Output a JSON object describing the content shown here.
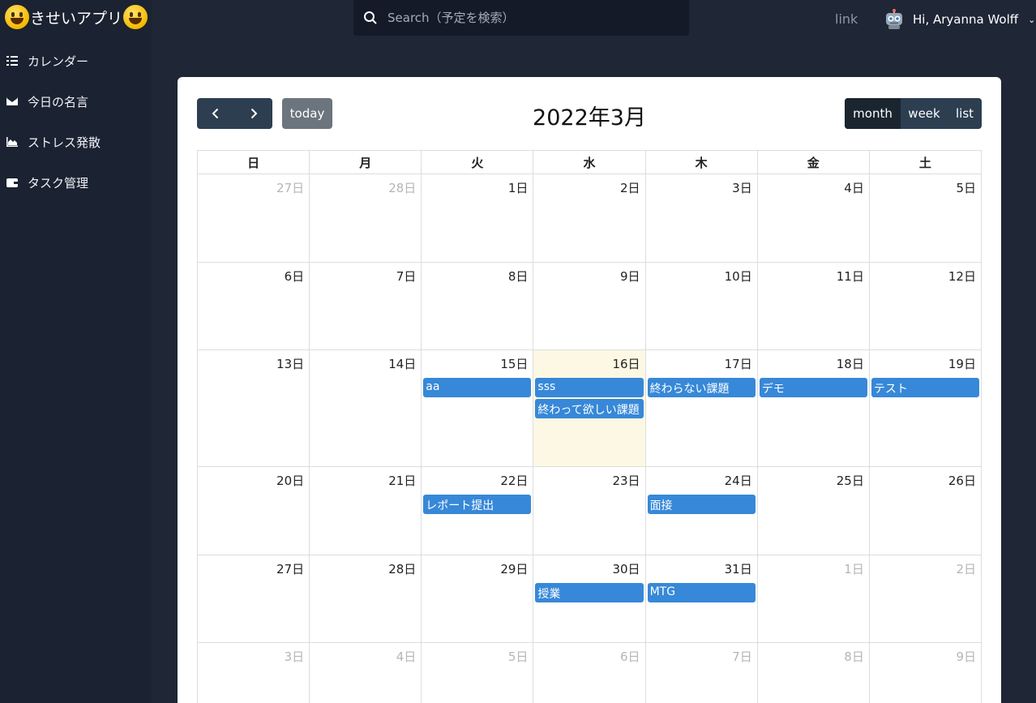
{
  "app": {
    "title": "きせいアプリ",
    "search_placeholder": "Search（予定を検索）",
    "link_label": "link",
    "user_greeting": "Hi, Aryanna Wolff",
    "accent": "#3788d8"
  },
  "sidebar": {
    "items": [
      {
        "label": "カレンダー",
        "icon": "list-icon"
      },
      {
        "label": "今日の名言",
        "icon": "envelope-icon"
      },
      {
        "label": "ストレス発散",
        "icon": "area-chart-icon"
      },
      {
        "label": "タスク管理",
        "icon": "wallet-icon"
      }
    ]
  },
  "calendar": {
    "title": "2022年3月",
    "today_label": "today",
    "views": {
      "month": "month",
      "week": "week",
      "list": "list"
    },
    "active_view": "month",
    "weekdays": [
      "日",
      "月",
      "火",
      "水",
      "木",
      "金",
      "土"
    ],
    "weeks": [
      [
        {
          "label": "27日",
          "other": true,
          "events": []
        },
        {
          "label": "28日",
          "other": true,
          "events": []
        },
        {
          "label": "1日",
          "events": []
        },
        {
          "label": "2日",
          "events": []
        },
        {
          "label": "3日",
          "events": []
        },
        {
          "label": "4日",
          "events": []
        },
        {
          "label": "5日",
          "events": []
        }
      ],
      [
        {
          "label": "6日",
          "events": []
        },
        {
          "label": "7日",
          "events": []
        },
        {
          "label": "8日",
          "events": []
        },
        {
          "label": "9日",
          "events": []
        },
        {
          "label": "10日",
          "events": []
        },
        {
          "label": "11日",
          "events": []
        },
        {
          "label": "12日",
          "events": []
        }
      ],
      [
        {
          "label": "13日",
          "events": []
        },
        {
          "label": "14日",
          "events": []
        },
        {
          "label": "15日",
          "events": [
            "aa"
          ]
        },
        {
          "label": "16日",
          "today": true,
          "events": [
            "sss",
            "終わって欲しい課題"
          ]
        },
        {
          "label": "17日",
          "events": [
            "終わらない課題"
          ]
        },
        {
          "label": "18日",
          "events": [
            "デモ"
          ]
        },
        {
          "label": "19日",
          "events": [
            "テスト"
          ]
        }
      ],
      [
        {
          "label": "20日",
          "events": []
        },
        {
          "label": "21日",
          "events": []
        },
        {
          "label": "22日",
          "events": [
            "レポート提出"
          ]
        },
        {
          "label": "23日",
          "events": []
        },
        {
          "label": "24日",
          "events": [
            "面接"
          ]
        },
        {
          "label": "25日",
          "events": []
        },
        {
          "label": "26日",
          "events": []
        }
      ],
      [
        {
          "label": "27日",
          "events": []
        },
        {
          "label": "28日",
          "events": []
        },
        {
          "label": "29日",
          "events": []
        },
        {
          "label": "30日",
          "events": [
            "授業"
          ]
        },
        {
          "label": "31日",
          "events": [
            "MTG"
          ]
        },
        {
          "label": "1日",
          "other": true,
          "events": []
        },
        {
          "label": "2日",
          "other": true,
          "events": []
        }
      ],
      [
        {
          "label": "3日",
          "other": true,
          "events": []
        },
        {
          "label": "4日",
          "other": true,
          "events": []
        },
        {
          "label": "5日",
          "other": true,
          "events": []
        },
        {
          "label": "6日",
          "other": true,
          "events": []
        },
        {
          "label": "7日",
          "other": true,
          "events": []
        },
        {
          "label": "8日",
          "other": true,
          "events": []
        },
        {
          "label": "9日",
          "other": true,
          "events": []
        }
      ]
    ]
  }
}
